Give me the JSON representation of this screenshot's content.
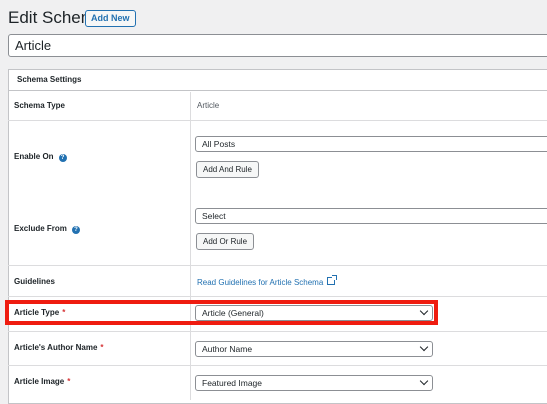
{
  "header": {
    "title": "Edit Schema",
    "add_new_label": "Add New"
  },
  "post_title": {
    "value": "Article"
  },
  "panel": {
    "title": "Schema Settings",
    "rows": {
      "schema_type": {
        "label": "Schema Type",
        "value": "Article"
      },
      "enable_on": {
        "label": "Enable On",
        "select_value": "All Posts",
        "button_label": "Add And Rule"
      },
      "exclude_from": {
        "label": "Exclude From",
        "select_value": "Select",
        "button_label": "Add Or Rule"
      },
      "guidelines": {
        "label": "Guidelines",
        "link_text": "Read Guidelines for Article Schema"
      },
      "article_type": {
        "label": "Article Type",
        "required_mark": "*",
        "select_value": "Article (General)"
      },
      "author_name": {
        "label": "Article's Author Name",
        "required_mark": "*",
        "select_value": "Author Name"
      },
      "article_image": {
        "label": "Article Image",
        "required_mark": "*",
        "select_value": "Featured Image"
      }
    }
  },
  "icons": {
    "help": "question-mark-icon",
    "external": "external-link-icon",
    "dropdown": "chevron-down-icon"
  },
  "colors": {
    "accent": "#2271b1",
    "highlight": "#ef1c10",
    "required": "#d63638"
  }
}
